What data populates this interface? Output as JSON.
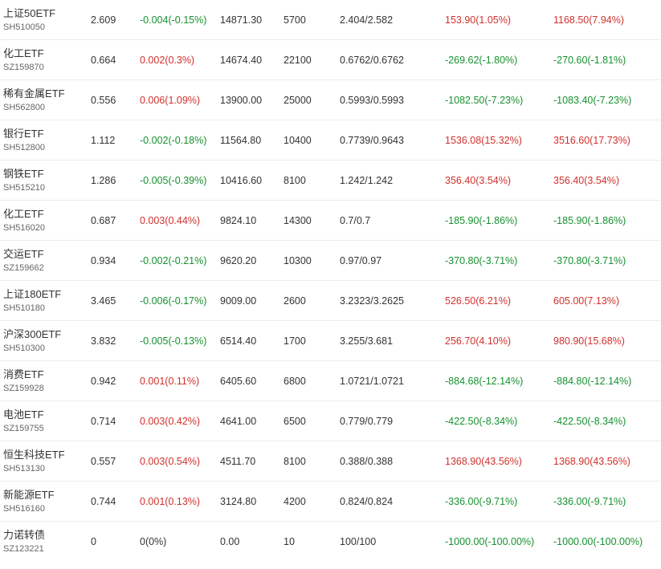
{
  "colors": {
    "up": "#d0312d",
    "down": "#16912f",
    "flat": "#333333"
  },
  "rows": [
    {
      "name": "上证50ETF",
      "code": "SH510050",
      "price": "2.609",
      "change": "-0.004(-0.15%)",
      "change_dir": "down",
      "value": "14871.30",
      "qty": "5700",
      "cost": "2.404/2.582",
      "pnl1": "153.90(1.05%)",
      "pnl1_dir": "up",
      "pnl2": "1168.50(7.94%)",
      "pnl2_dir": "up"
    },
    {
      "name": "化工ETF",
      "code": "SZ159870",
      "price": "0.664",
      "change": "0.002(0.3%)",
      "change_dir": "up",
      "value": "14674.40",
      "qty": "22100",
      "cost": "0.6762/0.6762",
      "pnl1": "-269.62(-1.80%)",
      "pnl1_dir": "down",
      "pnl2": "-270.60(-1.81%)",
      "pnl2_dir": "down"
    },
    {
      "name": "稀有金属ETF",
      "code": "SH562800",
      "price": "0.556",
      "change": "0.006(1.09%)",
      "change_dir": "up",
      "value": "13900.00",
      "qty": "25000",
      "cost": "0.5993/0.5993",
      "pnl1": "-1082.50(-7.23%)",
      "pnl1_dir": "down",
      "pnl2": "-1083.40(-7.23%)",
      "pnl2_dir": "down"
    },
    {
      "name": "银行ETF",
      "code": "SH512800",
      "price": "1.112",
      "change": "-0.002(-0.18%)",
      "change_dir": "down",
      "value": "11564.80",
      "qty": "10400",
      "cost": "0.7739/0.9643",
      "pnl1": "1536.08(15.32%)",
      "pnl1_dir": "up",
      "pnl2": "3516.60(17.73%)",
      "pnl2_dir": "up"
    },
    {
      "name": "钢铁ETF",
      "code": "SH515210",
      "price": "1.286",
      "change": "-0.005(-0.39%)",
      "change_dir": "down",
      "value": "10416.60",
      "qty": "8100",
      "cost": "1.242/1.242",
      "pnl1": "356.40(3.54%)",
      "pnl1_dir": "up",
      "pnl2": "356.40(3.54%)",
      "pnl2_dir": "up"
    },
    {
      "name": "化工ETF",
      "code": "SH516020",
      "price": "0.687",
      "change": "0.003(0.44%)",
      "change_dir": "up",
      "value": "9824.10",
      "qty": "14300",
      "cost": "0.7/0.7",
      "pnl1": "-185.90(-1.86%)",
      "pnl1_dir": "down",
      "pnl2": "-185.90(-1.86%)",
      "pnl2_dir": "down"
    },
    {
      "name": "交运ETF",
      "code": "SZ159662",
      "price": "0.934",
      "change": "-0.002(-0.21%)",
      "change_dir": "down",
      "value": "9620.20",
      "qty": "10300",
      "cost": "0.97/0.97",
      "pnl1": "-370.80(-3.71%)",
      "pnl1_dir": "down",
      "pnl2": "-370.80(-3.71%)",
      "pnl2_dir": "down"
    },
    {
      "name": "上证180ETF",
      "code": "SH510180",
      "price": "3.465",
      "change": "-0.006(-0.17%)",
      "change_dir": "down",
      "value": "9009.00",
      "qty": "2600",
      "cost": "3.2323/3.2625",
      "pnl1": "526.50(6.21%)",
      "pnl1_dir": "up",
      "pnl2": "605.00(7.13%)",
      "pnl2_dir": "up"
    },
    {
      "name": "沪深300ETF",
      "code": "SH510300",
      "price": "3.832",
      "change": "-0.005(-0.13%)",
      "change_dir": "down",
      "value": "6514.40",
      "qty": "1700",
      "cost": "3.255/3.681",
      "pnl1": "256.70(4.10%)",
      "pnl1_dir": "up",
      "pnl2": "980.90(15.68%)",
      "pnl2_dir": "up"
    },
    {
      "name": "消费ETF",
      "code": "SZ159928",
      "price": "0.942",
      "change": "0.001(0.11%)",
      "change_dir": "up",
      "value": "6405.60",
      "qty": "6800",
      "cost": "1.0721/1.0721",
      "pnl1": "-884.68(-12.14%)",
      "pnl1_dir": "down",
      "pnl2": "-884.80(-12.14%)",
      "pnl2_dir": "down"
    },
    {
      "name": "电池ETF",
      "code": "SZ159755",
      "price": "0.714",
      "change": "0.003(0.42%)",
      "change_dir": "up",
      "value": "4641.00",
      "qty": "6500",
      "cost": "0.779/0.779",
      "pnl1": "-422.50(-8.34%)",
      "pnl1_dir": "down",
      "pnl2": "-422.50(-8.34%)",
      "pnl2_dir": "down"
    },
    {
      "name": "恒生科技ETF",
      "code": "SH513130",
      "price": "0.557",
      "change": "0.003(0.54%)",
      "change_dir": "up",
      "value": "4511.70",
      "qty": "8100",
      "cost": "0.388/0.388",
      "pnl1": "1368.90(43.56%)",
      "pnl1_dir": "up",
      "pnl2": "1368.90(43.56%)",
      "pnl2_dir": "up"
    },
    {
      "name": "新能源ETF",
      "code": "SH516160",
      "price": "0.744",
      "change": "0.001(0.13%)",
      "change_dir": "up",
      "value": "3124.80",
      "qty": "4200",
      "cost": "0.824/0.824",
      "pnl1": "-336.00(-9.71%)",
      "pnl1_dir": "down",
      "pnl2": "-336.00(-9.71%)",
      "pnl2_dir": "down"
    },
    {
      "name": "力诺转债",
      "code": "SZ123221",
      "price": "0",
      "change": "0(0%)",
      "change_dir": "flat",
      "value": "0.00",
      "qty": "10",
      "cost": "100/100",
      "pnl1": "-1000.00(-100.00%)",
      "pnl1_dir": "down",
      "pnl2": "-1000.00(-100.00%)",
      "pnl2_dir": "down"
    }
  ]
}
